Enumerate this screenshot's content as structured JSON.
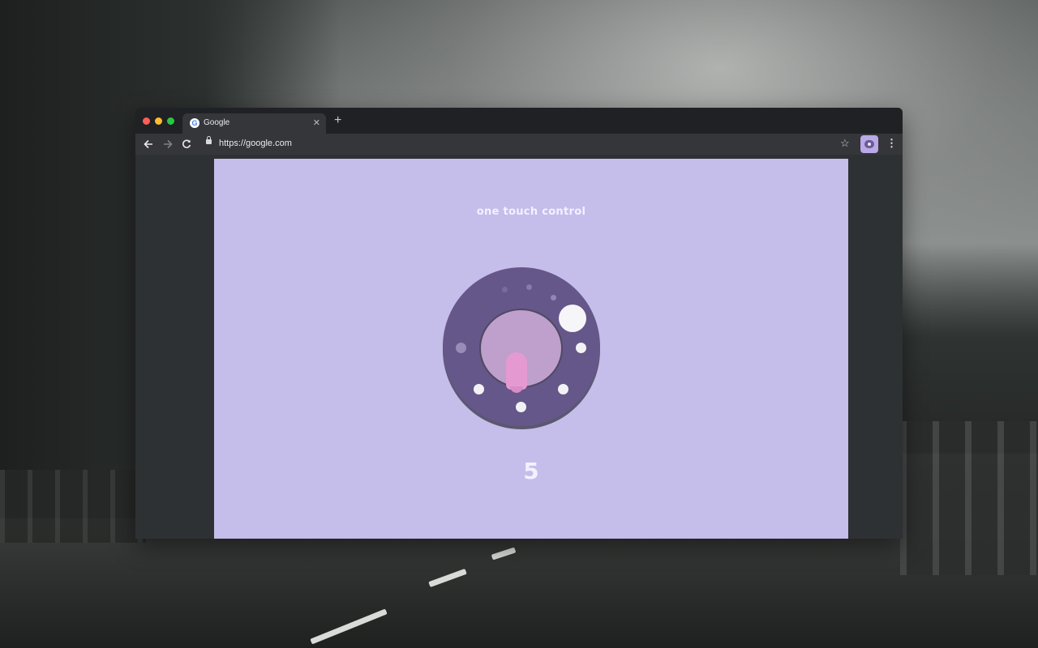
{
  "browser": {
    "tab": {
      "title": "Google",
      "favicon": "google-g-icon"
    },
    "url": "https://google.com",
    "icons": {
      "back": "arrow-left-icon",
      "forward": "arrow-right-icon",
      "reload": "reload-icon",
      "lock": "lock-icon",
      "bookmark": "star-icon",
      "extension": "toggle-switch-icon",
      "menu": "vertical-dots-icon"
    }
  },
  "page": {
    "title": "one touch control",
    "value": "5",
    "colors": {
      "background": "#c5bdea",
      "dial": "#655789",
      "knob": "#bf9fcc",
      "handle": "#e49ad1",
      "text": "#f4f1ff"
    }
  }
}
